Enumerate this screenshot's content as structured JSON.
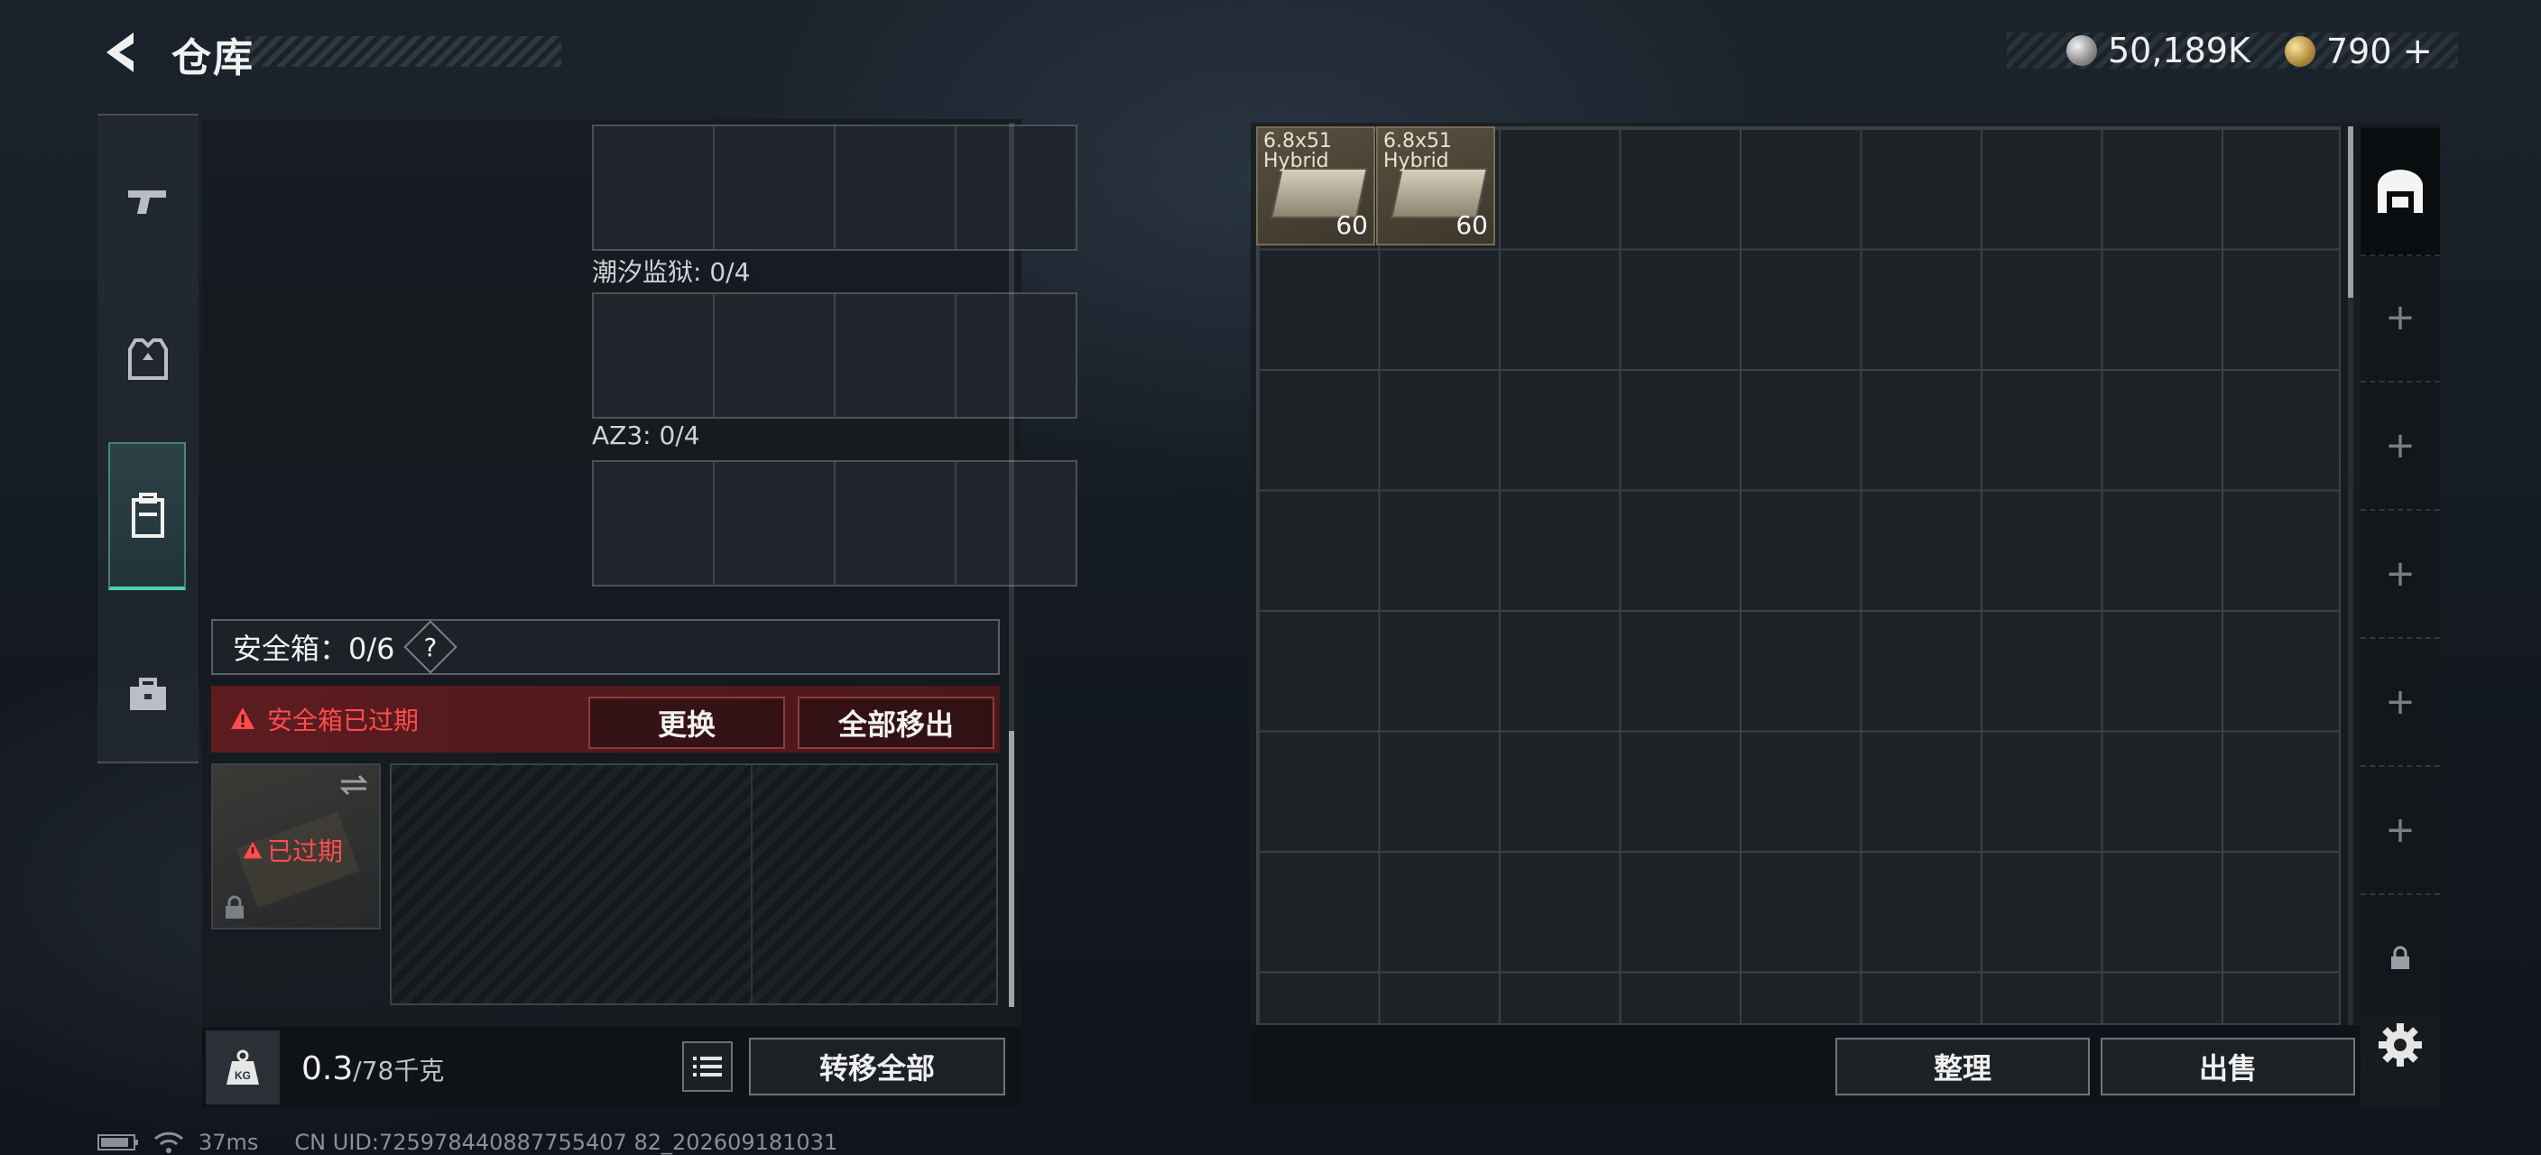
{
  "header": {
    "title": "仓库",
    "currency": [
      {
        "icon": "silver-coin-icon",
        "value": "50,189K"
      },
      {
        "icon": "gold-coin-icon",
        "value": "790",
        "suffix": "+"
      }
    ]
  },
  "sidebar": {
    "items": [
      {
        "icon": "pistol-icon"
      },
      {
        "icon": "armor-vest-icon"
      },
      {
        "icon": "backpack-icon",
        "active": true
      },
      {
        "icon": "toolbox-icon"
      }
    ]
  },
  "loadout": {
    "slots": [
      {
        "label": ""
      },
      {
        "label": "潮汐监狱: 0/4"
      },
      {
        "label": "AZ3: 0/4"
      }
    ],
    "safebox": {
      "label": "安全箱：0/6",
      "help": "?",
      "expired_notice": "安全箱已过期",
      "replace_button": "更换",
      "remove_all_button": "全部移出",
      "thumb_status": "已过期"
    },
    "weight": {
      "current": "0.3",
      "max": "/78千克",
      "unit_icon": "KG"
    },
    "transfer_all_button": "转移全部"
  },
  "stash": {
    "items": [
      {
        "name_line1": "6.8x51",
        "name_line2": "Hybrid",
        "count": "60"
      },
      {
        "name_line1": "6.8x51",
        "name_line2": "Hybrid",
        "count": "60"
      }
    ],
    "sort_button": "整理",
    "sell_button": "出售",
    "tab_add": "+"
  },
  "status_bar": {
    "ping": "37ms",
    "uid": "CN UID:725978440887755407 82_202609181031"
  },
  "colors": {
    "accent": "#4fd0b4",
    "alert": "#ff4b4b",
    "alert_bg": "#5c1c20"
  }
}
